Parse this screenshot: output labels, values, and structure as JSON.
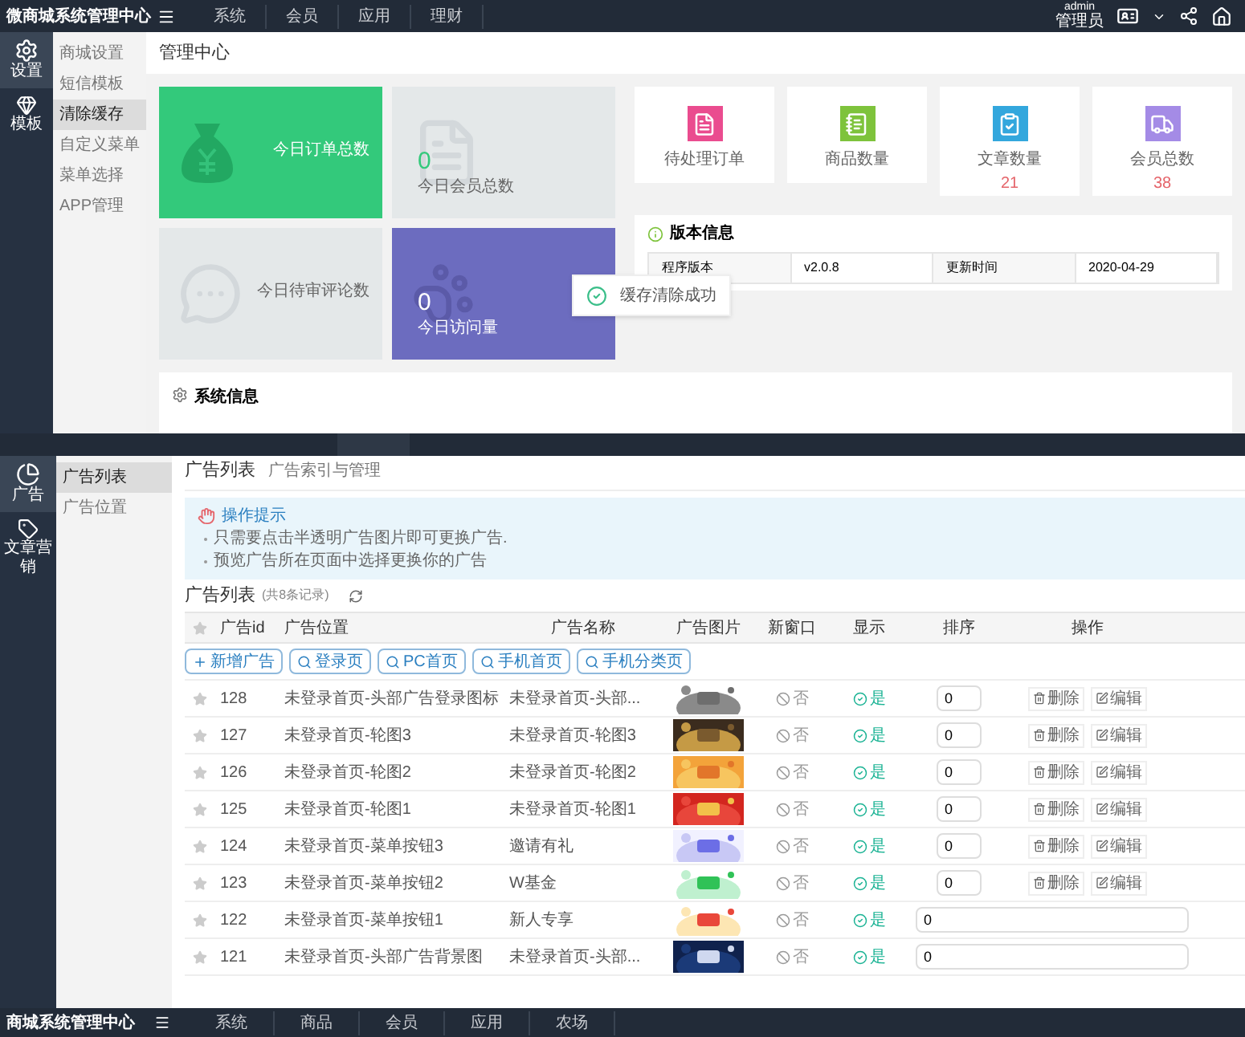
{
  "dashboard": {
    "header": {
      "title": "微商城系统管理中心",
      "nav": [
        "系统",
        "会员",
        "应用",
        "理财"
      ],
      "user_name": "admin",
      "user_role": "管理员"
    },
    "rail": [
      {
        "label": "设置",
        "selected": true
      },
      {
        "label": "模板",
        "selected": false
      }
    ],
    "submenu": [
      {
        "label": "商城设置",
        "selected": false
      },
      {
        "label": "短信模板",
        "selected": false
      },
      {
        "label": "清除缓存",
        "selected": true
      },
      {
        "label": "自定义菜单",
        "selected": false
      },
      {
        "label": "菜单选择",
        "selected": false
      },
      {
        "label": "APP管理",
        "selected": false
      }
    ],
    "page_title": "管理中心",
    "stat_cards": [
      {
        "kind": "money",
        "label": "今日订单总数"
      },
      {
        "kind": "file",
        "value": "0",
        "label": "今日会员总数"
      },
      {
        "kind": "comment",
        "label": "今日待审评论数"
      },
      {
        "kind": "paw",
        "value": "0",
        "label": "今日访问量"
      }
    ],
    "counters": [
      {
        "kind": "order",
        "label": "待处理订单"
      },
      {
        "kind": "goods",
        "label": "商品数量"
      },
      {
        "kind": "article",
        "label": "文章数量",
        "value": "21"
      },
      {
        "kind": "member",
        "label": "会员总数",
        "value": "38"
      }
    ],
    "version": {
      "title": "版本信息",
      "cells": [
        "程序版本",
        "v2.0.8",
        "更新时间",
        "2020-04-29"
      ]
    },
    "toast": "缓存清除成功",
    "system_info_title": "系统信息"
  },
  "ads": {
    "rail": [
      {
        "label": "广告",
        "selected": true
      },
      {
        "label": "文章营销",
        "selected": false
      }
    ],
    "submenu": [
      {
        "label": "广告列表",
        "selected": true
      },
      {
        "label": "广告位置",
        "selected": false
      }
    ],
    "page_title": "广告列表",
    "page_subtitle": "广告索引与管理",
    "tips": {
      "title": "操作提示",
      "items": [
        "只需要点击半透明广告图片即可更换广告.",
        "预览广告所在页面中选择更换你的广告"
      ]
    },
    "list_title": "广告列表",
    "list_count": "(共8条记录)",
    "columns": [
      "广告id",
      "广告位置",
      "广告名称",
      "广告图片",
      "新窗口",
      "显示",
      "排序",
      "操作"
    ],
    "buttons": [
      {
        "kind": "add",
        "label": "新增广告"
      },
      {
        "kind": "search",
        "label": "登录页"
      },
      {
        "kind": "search",
        "label": "PC首页"
      },
      {
        "kind": "search",
        "label": "手机首页"
      },
      {
        "kind": "search",
        "label": "手机分类页"
      }
    ],
    "rows": [
      {
        "id": "128",
        "position": "未登录首页-头部广告登录图标",
        "name": "未登录首页-头部...",
        "new_window": false,
        "new_window_label": "否",
        "shown": true,
        "shown_label": "是",
        "sort": "0",
        "actions": [
          "删除",
          "编辑"
        ]
      },
      {
        "id": "127",
        "position": "未登录首页-轮图3",
        "name": "未登录首页-轮图3",
        "new_window": false,
        "new_window_label": "否",
        "shown": true,
        "shown_label": "是",
        "sort": "0",
        "actions": [
          "删除",
          "编辑"
        ]
      },
      {
        "id": "126",
        "position": "未登录首页-轮图2",
        "name": "未登录首页-轮图2",
        "new_window": false,
        "new_window_label": "否",
        "shown": true,
        "shown_label": "是",
        "sort": "0",
        "actions": [
          "删除",
          "编辑"
        ]
      },
      {
        "id": "125",
        "position": "未登录首页-轮图1",
        "name": "未登录首页-轮图1",
        "new_window": false,
        "new_window_label": "否",
        "shown": true,
        "shown_label": "是",
        "sort": "0",
        "actions": [
          "删除",
          "编辑"
        ]
      },
      {
        "id": "124",
        "position": "未登录首页-菜单按钮3",
        "name": "邀请有礼",
        "new_window": false,
        "new_window_label": "否",
        "shown": true,
        "shown_label": "是",
        "sort": "0",
        "actions": [
          "删除",
          "编辑"
        ]
      },
      {
        "id": "123",
        "position": "未登录首页-菜单按钮2",
        "name": "W基金",
        "new_window": false,
        "new_window_label": "否",
        "shown": true,
        "shown_label": "是",
        "sort": "0",
        "actions": [
          "删除",
          "编辑"
        ]
      },
      {
        "id": "122",
        "position": "未登录首页-菜单按钮1",
        "name": "新人专享",
        "new_window": false,
        "new_window_label": "否",
        "shown": true,
        "shown_label": "是",
        "sort": "0"
      },
      {
        "id": "121",
        "position": "未登录首页-头部广告背景图",
        "name": "未登录首页-头部...",
        "new_window": false,
        "new_window_label": "否",
        "shown": true,
        "shown_label": "是",
        "sort": "0"
      }
    ]
  },
  "footer_bar": {
    "title": "商城系统管理中心",
    "nav": [
      "系统",
      "商品",
      "会员",
      "应用",
      "农场"
    ]
  }
}
